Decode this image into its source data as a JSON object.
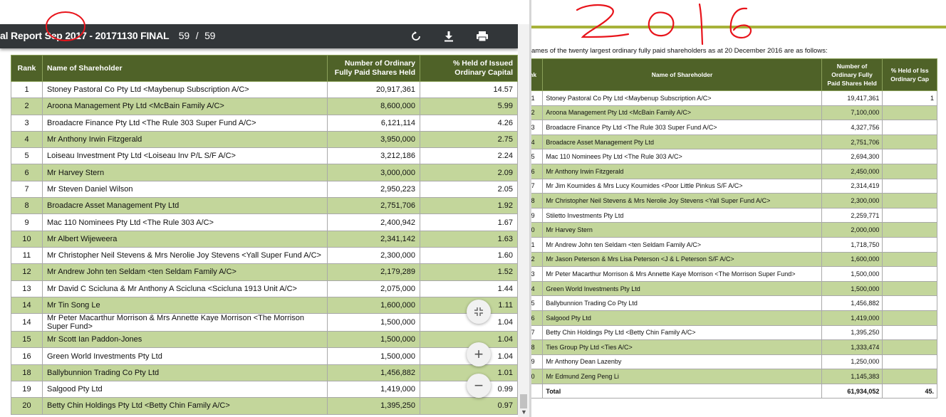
{
  "left": {
    "toolbar": {
      "title": "al Report Sep 2017 - 20171130 FINAL",
      "page_current": "59",
      "page_sep": "/",
      "page_total": "59",
      "icons": [
        "rotate-icon",
        "download-icon",
        "print-icon"
      ]
    },
    "table": {
      "headers": [
        "Rank",
        "Name of Shareholder",
        "Number of Ordinary Fully Paid Shares Held",
        "% Held of Issued Ordinary Capital"
      ],
      "rows": [
        [
          "1",
          "Stoney Pastoral Co Pty Ltd <Maybenup Subscription A/C>",
          "20,917,361",
          "14.57"
        ],
        [
          "2",
          "Aroona Management Pty Ltd <McBain Family A/C>",
          "8,600,000",
          "5.99"
        ],
        [
          "3",
          "Broadacre Finance Pty Ltd <The Rule 303 Super Fund A/C>",
          "6,121,114",
          "4.26"
        ],
        [
          "4",
          "Mr Anthony Irwin Fitzgerald",
          "3,950,000",
          "2.75"
        ],
        [
          "5",
          "Loiseau Investment Pty Ltd <Loiseau Inv P/L S/F A/C>",
          "3,212,186",
          "2.24"
        ],
        [
          "6",
          "Mr Harvey Stern",
          "3,000,000",
          "2.09"
        ],
        [
          "7",
          "Mr Steven Daniel Wilson",
          "2,950,223",
          "2.05"
        ],
        [
          "8",
          "Broadacre Asset Management Pty Ltd",
          "2,751,706",
          "1.92"
        ],
        [
          "9",
          "Mac 110 Nominees Pty Ltd <The Rule 303 A/C>",
          "2,400,942",
          "1.67"
        ],
        [
          "10",
          "Mr Albert Wijeweera",
          "2,341,142",
          "1.63"
        ],
        [
          "11",
          "Mr Christopher Neil Stevens & Mrs Nerolie Joy Stevens <Yall Super Fund A/C>",
          "2,300,000",
          "1.60"
        ],
        [
          "12",
          "Mr Andrew John ten Seldam <ten Seldam Family A/C>",
          "2,179,289",
          "1.52"
        ],
        [
          "13",
          "Mr David C Scicluna & Mr Anthony A Scicluna <Scicluna 1913 Unit A/C>",
          "2,075,000",
          "1.44"
        ],
        [
          "14",
          "Mr Tin Song Le",
          "1,600,000",
          "1.11"
        ],
        [
          "14",
          "Mr Peter Macarthur Morrison & Mrs Annette Kaye Morrison <The Morrison Super Fund>",
          "1,500,000",
          "1.04"
        ],
        [
          "15",
          "Mr Scott Ian Paddon-Jones",
          "1,500,000",
          "1.04"
        ],
        [
          "16",
          "Green World Investments Pty Ltd",
          "1,500,000",
          "1.04"
        ],
        [
          "18",
          "Ballybunnion Trading Co Pty Ltd",
          "1,456,882",
          "1.01"
        ],
        [
          "19",
          "Salgood Pty Ltd",
          "1,419,000",
          "0.99"
        ],
        [
          "20",
          "Betty Chin Holdings Pty Ltd <Betty Chin Family A/C>",
          "1,395,250",
          "0.97"
        ]
      ]
    },
    "zoom": {
      "fit_label": "⤡",
      "in_label": "+",
      "out_label": "−"
    }
  },
  "right": {
    "intro": "ames of the twenty largest ordinary fully paid shareholders as at 20 December 2016 are as follows:",
    "table": {
      "headers": [
        "nk",
        "Name of Shareholder",
        "Number of Ordinary Fully Paid Shares Held",
        "% Held of Iss Ordinary Cap"
      ],
      "rows": [
        [
          "1",
          "Stoney Pastoral Co Pty Ltd <Maybenup Subscription A/C>",
          "19,417,361",
          "1"
        ],
        [
          "2",
          "Aroona Management Pty Ltd <McBain Family A/C>",
          "7,100,000",
          ""
        ],
        [
          "3",
          "Broadacre Finance Pty Ltd <The Rule 303 Super Fund A/C>",
          "4,327,756",
          ""
        ],
        [
          "4",
          "Broadacre Asset Management Pty Ltd",
          "2,751,706",
          ""
        ],
        [
          "5",
          "Mac 110 Nominees Pty Ltd <The Rule 303 A/C>",
          "2,694,300",
          ""
        ],
        [
          "6",
          "Mr Anthony Irwin Fitzgerald",
          "2,450,000",
          ""
        ],
        [
          "7",
          "Mr Jim Koumides & Mrs Lucy Koumides <Poor Little Pinkus S/F A/C>",
          "2,314,419",
          ""
        ],
        [
          "8",
          "Mr Christopher Neil Stevens & Mrs Nerolie Joy Stevens <Yall Super Fund A/C>",
          "2,300,000",
          ""
        ],
        [
          "9",
          "Stiletto Investments Pty Ltd",
          "2,259,771",
          ""
        ],
        [
          "0",
          "Mr Harvey Stern",
          "2,000,000",
          ""
        ],
        [
          "1",
          "Mr Andrew John ten Seldam <ten Seldam Family A/C>",
          "1,718,750",
          ""
        ],
        [
          "2",
          "Mr Jason Peterson & Mrs Lisa Peterson <J & L Peterson S/F A/C>",
          "1,600,000",
          ""
        ],
        [
          "3",
          "Mr Peter Macarthur Morrison & Mrs Annette Kaye Morrison <The Morrison Super Fund>",
          "1,500,000",
          ""
        ],
        [
          "4",
          "Green World Investments Pty Ltd",
          "1,500,000",
          ""
        ],
        [
          "5",
          "Ballybunnion Trading Co Pty Ltd",
          "1,456,882",
          ""
        ],
        [
          "6",
          "Salgood Pty Ltd",
          "1,419,000",
          ""
        ],
        [
          "7",
          "Betty Chin Holdings Pty Ltd <Betty Chin Family A/C>",
          "1,395,250",
          ""
        ],
        [
          "8",
          "Ties Group Pty Ltd <Ties A/C>",
          "1,333,474",
          ""
        ],
        [
          "9",
          "Mr Anthony Dean Lazenby",
          "1,250,000",
          ""
        ],
        [
          "0",
          "Mr Edmund Zeng Peng Li",
          "1,145,383",
          ""
        ]
      ],
      "total": [
        "",
        "Total",
        "61,934,052",
        "45."
      ]
    },
    "annotation": "2016"
  },
  "colors": {
    "header_green": "#4f6228",
    "row_green": "#c3d69b",
    "toolbar": "#323639",
    "annotation_red": "#e8141b"
  }
}
